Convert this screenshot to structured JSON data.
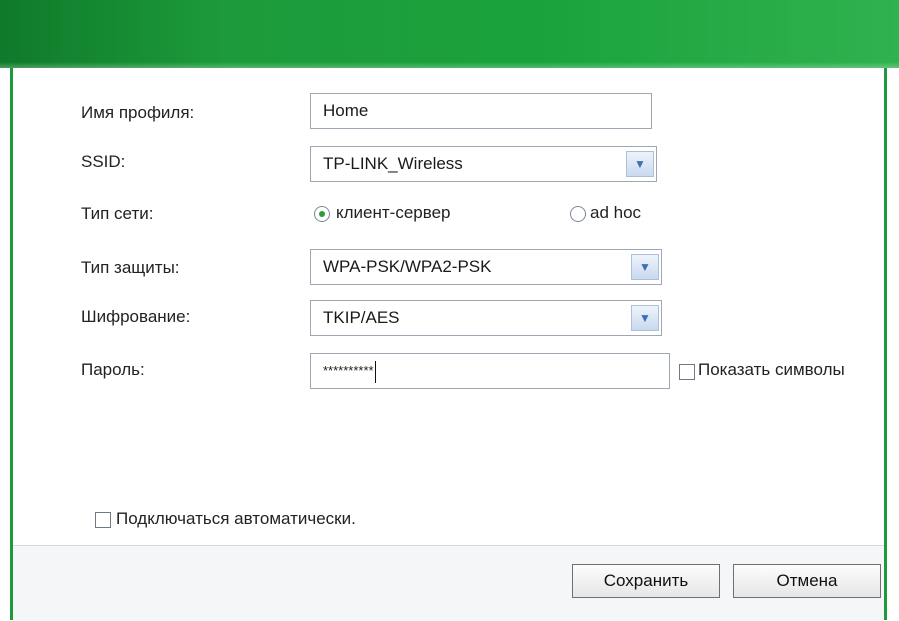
{
  "form": {
    "profile_name_label": "Имя профиля:",
    "profile_name_value": "Home",
    "ssid_label": "SSID:",
    "ssid_value": "TP-LINK_Wireless",
    "network_type_label": "Тип сети:",
    "network_type_option_infrastructure": "клиент-сервер",
    "network_type_option_adhoc": "ad hoc",
    "network_type_selected": "клиент-сервер",
    "security_type_label": "Тип защиты:",
    "security_type_value": "WPA-PSK/WPA2-PSK",
    "encryption_label": "Шифрование:",
    "encryption_value": "TKIP/AES",
    "password_label": "Пароль:",
    "password_value": "**********",
    "show_chars_label": "Показать символы",
    "show_chars_checked": false,
    "auto_connect_label": "Подключаться автоматически.",
    "auto_connect_checked": false
  },
  "buttons": {
    "save_label": "Сохранить",
    "cancel_label": "Отмена"
  },
  "colors": {
    "header_green": "#1d9a3b",
    "radio_selected": "#2a9a3a"
  }
}
